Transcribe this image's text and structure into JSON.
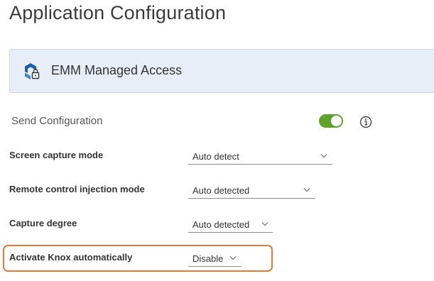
{
  "page": {
    "title": "Application Configuration"
  },
  "banner": {
    "title": "EMM Managed Access",
    "icon": "emm-managed-access-icon"
  },
  "send_configuration": {
    "label": "Send Configuration",
    "enabled": true,
    "info_icon": "info-icon"
  },
  "settings": [
    {
      "label": "Screen capture mode",
      "value": "Auto detect"
    },
    {
      "label": "Remote control injection mode",
      "value": "Auto detected"
    },
    {
      "label": "Capture degree",
      "value": "Auto detected"
    },
    {
      "label": "Activate Knox automatically",
      "value": "Disable"
    }
  ],
  "colors": {
    "accent_toggle": "#5fa32f",
    "highlight_border": "#e07b39",
    "banner_bg": "#e8eef7",
    "icon_blue": "#1c5fa8"
  }
}
